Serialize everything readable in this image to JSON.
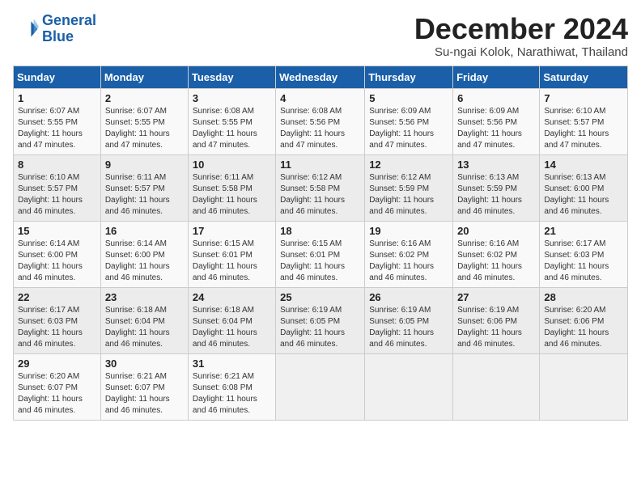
{
  "header": {
    "logo_line1": "General",
    "logo_line2": "Blue",
    "month": "December 2024",
    "location": "Su-ngai Kolok, Narathiwat, Thailand"
  },
  "days_of_week": [
    "Sunday",
    "Monday",
    "Tuesday",
    "Wednesday",
    "Thursday",
    "Friday",
    "Saturday"
  ],
  "weeks": [
    [
      {
        "day": "1",
        "info": "Sunrise: 6:07 AM\nSunset: 5:55 PM\nDaylight: 11 hours\nand 47 minutes."
      },
      {
        "day": "2",
        "info": "Sunrise: 6:07 AM\nSunset: 5:55 PM\nDaylight: 11 hours\nand 47 minutes."
      },
      {
        "day": "3",
        "info": "Sunrise: 6:08 AM\nSunset: 5:55 PM\nDaylight: 11 hours\nand 47 minutes."
      },
      {
        "day": "4",
        "info": "Sunrise: 6:08 AM\nSunset: 5:56 PM\nDaylight: 11 hours\nand 47 minutes."
      },
      {
        "day": "5",
        "info": "Sunrise: 6:09 AM\nSunset: 5:56 PM\nDaylight: 11 hours\nand 47 minutes."
      },
      {
        "day": "6",
        "info": "Sunrise: 6:09 AM\nSunset: 5:56 PM\nDaylight: 11 hours\nand 47 minutes."
      },
      {
        "day": "7",
        "info": "Sunrise: 6:10 AM\nSunset: 5:57 PM\nDaylight: 11 hours\nand 47 minutes."
      }
    ],
    [
      {
        "day": "8",
        "info": "Sunrise: 6:10 AM\nSunset: 5:57 PM\nDaylight: 11 hours\nand 46 minutes."
      },
      {
        "day": "9",
        "info": "Sunrise: 6:11 AM\nSunset: 5:57 PM\nDaylight: 11 hours\nand 46 minutes."
      },
      {
        "day": "10",
        "info": "Sunrise: 6:11 AM\nSunset: 5:58 PM\nDaylight: 11 hours\nand 46 minutes."
      },
      {
        "day": "11",
        "info": "Sunrise: 6:12 AM\nSunset: 5:58 PM\nDaylight: 11 hours\nand 46 minutes."
      },
      {
        "day": "12",
        "info": "Sunrise: 6:12 AM\nSunset: 5:59 PM\nDaylight: 11 hours\nand 46 minutes."
      },
      {
        "day": "13",
        "info": "Sunrise: 6:13 AM\nSunset: 5:59 PM\nDaylight: 11 hours\nand 46 minutes."
      },
      {
        "day": "14",
        "info": "Sunrise: 6:13 AM\nSunset: 6:00 PM\nDaylight: 11 hours\nand 46 minutes."
      }
    ],
    [
      {
        "day": "15",
        "info": "Sunrise: 6:14 AM\nSunset: 6:00 PM\nDaylight: 11 hours\nand 46 minutes."
      },
      {
        "day": "16",
        "info": "Sunrise: 6:14 AM\nSunset: 6:00 PM\nDaylight: 11 hours\nand 46 minutes."
      },
      {
        "day": "17",
        "info": "Sunrise: 6:15 AM\nSunset: 6:01 PM\nDaylight: 11 hours\nand 46 minutes."
      },
      {
        "day": "18",
        "info": "Sunrise: 6:15 AM\nSunset: 6:01 PM\nDaylight: 11 hours\nand 46 minutes."
      },
      {
        "day": "19",
        "info": "Sunrise: 6:16 AM\nSunset: 6:02 PM\nDaylight: 11 hours\nand 46 minutes."
      },
      {
        "day": "20",
        "info": "Sunrise: 6:16 AM\nSunset: 6:02 PM\nDaylight: 11 hours\nand 46 minutes."
      },
      {
        "day": "21",
        "info": "Sunrise: 6:17 AM\nSunset: 6:03 PM\nDaylight: 11 hours\nand 46 minutes."
      }
    ],
    [
      {
        "day": "22",
        "info": "Sunrise: 6:17 AM\nSunset: 6:03 PM\nDaylight: 11 hours\nand 46 minutes."
      },
      {
        "day": "23",
        "info": "Sunrise: 6:18 AM\nSunset: 6:04 PM\nDaylight: 11 hours\nand 46 minutes."
      },
      {
        "day": "24",
        "info": "Sunrise: 6:18 AM\nSunset: 6:04 PM\nDaylight: 11 hours\nand 46 minutes."
      },
      {
        "day": "25",
        "info": "Sunrise: 6:19 AM\nSunset: 6:05 PM\nDaylight: 11 hours\nand 46 minutes."
      },
      {
        "day": "26",
        "info": "Sunrise: 6:19 AM\nSunset: 6:05 PM\nDaylight: 11 hours\nand 46 minutes."
      },
      {
        "day": "27",
        "info": "Sunrise: 6:19 AM\nSunset: 6:06 PM\nDaylight: 11 hours\nand 46 minutes."
      },
      {
        "day": "28",
        "info": "Sunrise: 6:20 AM\nSunset: 6:06 PM\nDaylight: 11 hours\nand 46 minutes."
      }
    ],
    [
      {
        "day": "29",
        "info": "Sunrise: 6:20 AM\nSunset: 6:07 PM\nDaylight: 11 hours\nand 46 minutes."
      },
      {
        "day": "30",
        "info": "Sunrise: 6:21 AM\nSunset: 6:07 PM\nDaylight: 11 hours\nand 46 minutes."
      },
      {
        "day": "31",
        "info": "Sunrise: 6:21 AM\nSunset: 6:08 PM\nDaylight: 11 hours\nand 46 minutes."
      },
      null,
      null,
      null,
      null
    ]
  ]
}
